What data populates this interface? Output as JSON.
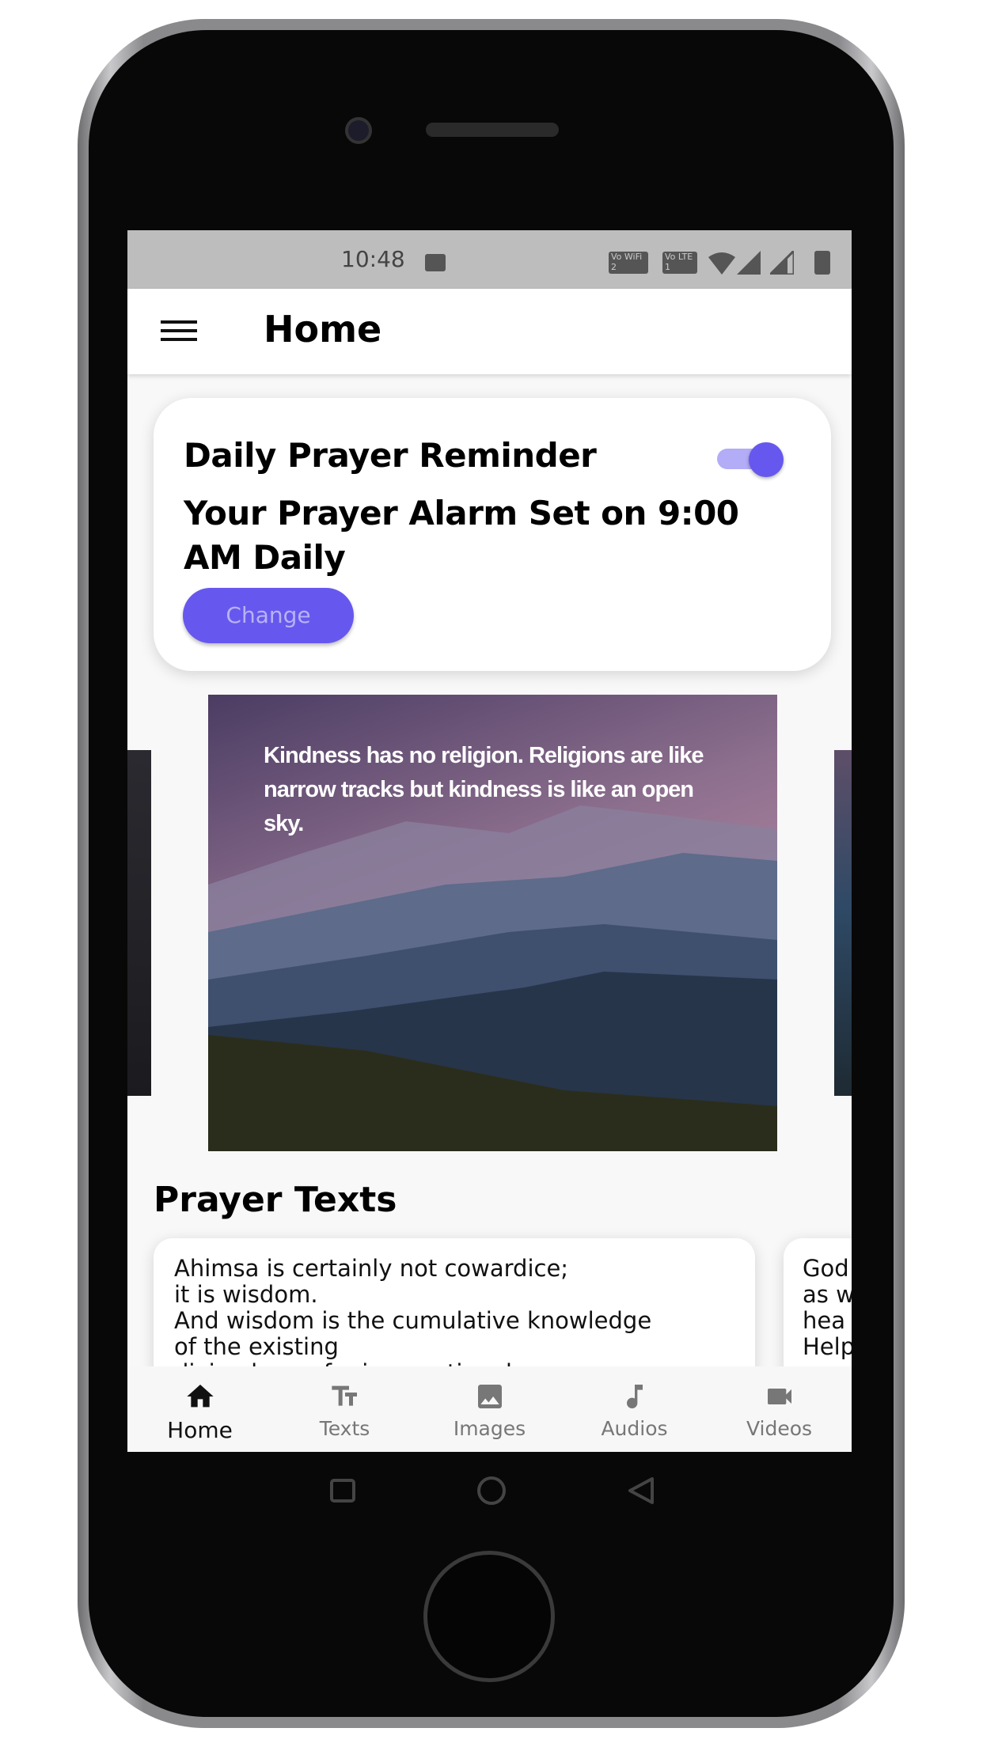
{
  "status_bar": {
    "time": "10:48",
    "indicators": [
      "image-icon",
      "vowifi2-icon",
      "volte1-icon",
      "wifi-icon",
      "signal-icon",
      "signal-icon",
      "battery-icon"
    ],
    "vowifi": "Vo WiFi 2",
    "volte": "Vo LTE 1"
  },
  "app_bar": {
    "title": "Home",
    "menu_icon": "hamburger-icon"
  },
  "reminder_card": {
    "title": "Daily Prayer Reminder",
    "toggle_on": true,
    "message": "Your Prayer Alarm Set on 9:00 AM Daily",
    "change_label": "Change"
  },
  "carousel": {
    "quote": "Kindness has no religion. Religions are like narrow tracks but kindness is like an open sky."
  },
  "prayer_texts": {
    "heading": "Prayer Texts",
    "cards": [
      {
        "lines": [
          "Ahimsa is certainly not cowardice;",
          "it is wisdom.",
          "And wisdom is the cumulative knowledge",
          "of the existing",
          "divine laws of reincarnation, karma"
        ]
      },
      {
        "lines": [
          "God",
          "as w",
          "hea",
          "Help"
        ]
      }
    ]
  },
  "bottom_nav": {
    "items": [
      {
        "label": "Home",
        "icon": "home-icon",
        "active": true
      },
      {
        "label": "Texts",
        "icon": "text-format-icon",
        "active": false
      },
      {
        "label": "Images",
        "icon": "image-icon",
        "active": false
      },
      {
        "label": "Audios",
        "icon": "music-note-icon",
        "active": false
      },
      {
        "label": "Videos",
        "icon": "videocam-icon",
        "active": false
      }
    ]
  },
  "colors": {
    "accent": "#6658ee",
    "toggle_track": "#b3acf6",
    "change_text": "#b8b2f5"
  }
}
